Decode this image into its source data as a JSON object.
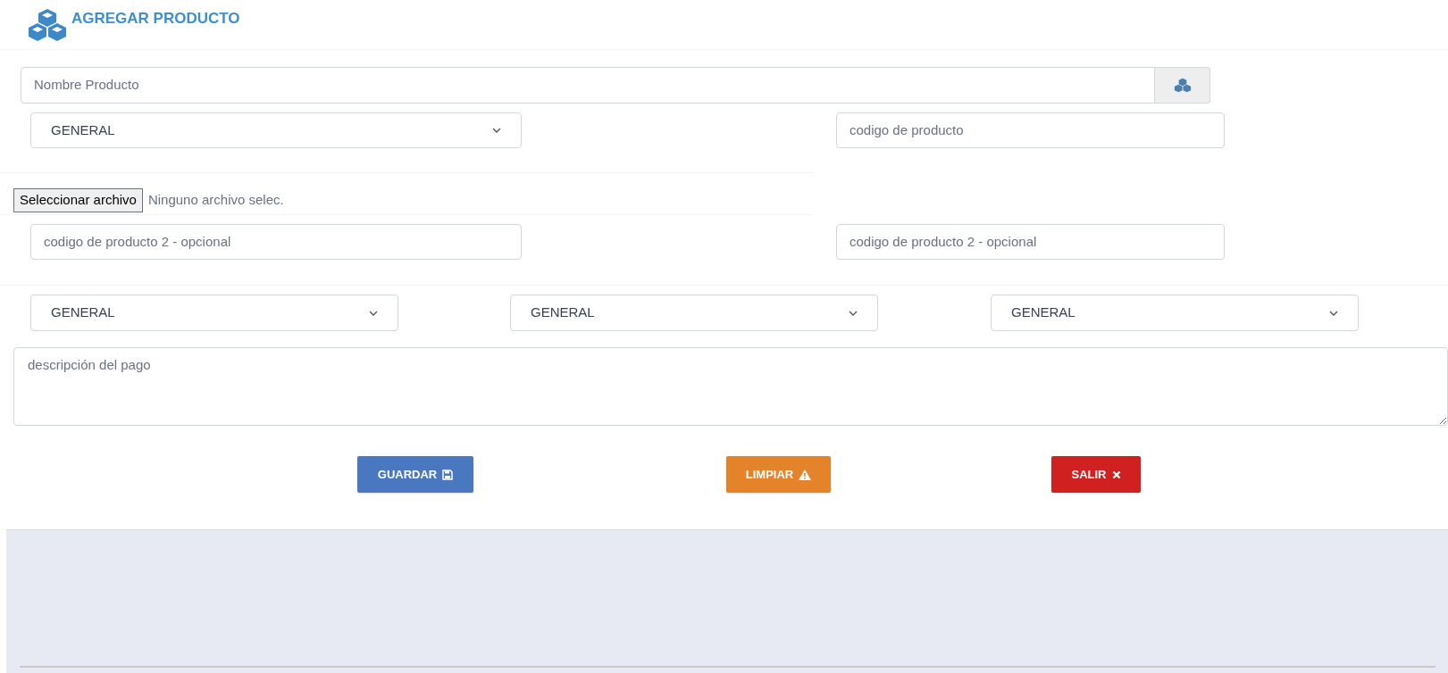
{
  "title": "AGREGAR PRODUCTO",
  "name_field": {
    "placeholder": "Nombre Producto"
  },
  "category_select": {
    "value": "GENERAL"
  },
  "code_field": {
    "placeholder": "codigo de producto"
  },
  "file_input": {
    "button": "Seleccionar archivo",
    "status": "Ninguno archivo selec."
  },
  "code2_fields": [
    {
      "placeholder": "codigo de producto 2 - opcional"
    },
    {
      "placeholder": "codigo de producto 2 - opcional"
    }
  ],
  "selects": [
    {
      "value": "GENERAL"
    },
    {
      "value": "GENERAL"
    },
    {
      "value": "GENERAL"
    }
  ],
  "description": {
    "placeholder": "descripción del pago"
  },
  "buttons": [
    {
      "label": "GUARDAR",
      "kind": "save"
    },
    {
      "label": "LIMPIAR",
      "kind": "clear"
    },
    {
      "label": "SALIR",
      "kind": "exit"
    }
  ]
}
